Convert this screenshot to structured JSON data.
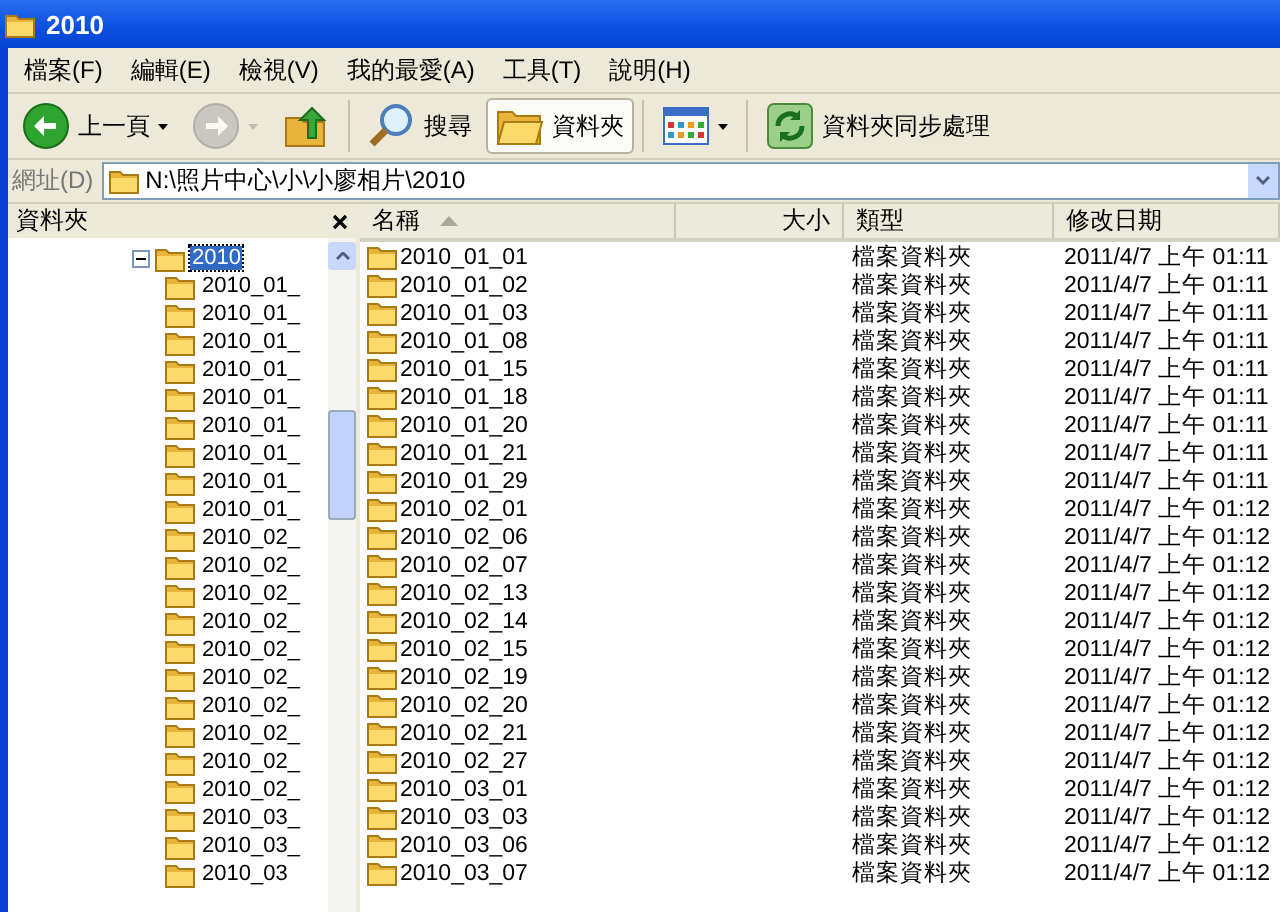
{
  "window": {
    "title": "2010"
  },
  "menu": [
    {
      "label": "檔案(F)"
    },
    {
      "label": "編輯(E)"
    },
    {
      "label": "檢視(V)"
    },
    {
      "label": "我的最愛(A)"
    },
    {
      "label": "工具(T)"
    },
    {
      "label": "說明(H)"
    }
  ],
  "toolbar": [
    {
      "kind": "back",
      "label": "上一頁",
      "disabled": false,
      "pressed": false
    },
    {
      "kind": "forward",
      "disabled": true,
      "pressed": false
    },
    {
      "kind": "up",
      "disabled": false,
      "pressed": false
    },
    {
      "kind": "search",
      "label": "搜尋",
      "disabled": false,
      "pressed": false
    },
    {
      "kind": "folders",
      "label": "資料夾",
      "disabled": false,
      "pressed": true
    },
    {
      "kind": "views",
      "disabled": false,
      "pressed": false
    },
    {
      "kind": "sync",
      "label": "資料夾同步處理",
      "disabled": false,
      "pressed": false
    }
  ],
  "address": {
    "label": "網址(D)",
    "value": "N:\\照片中心\\小\\小廖相片\\2010"
  },
  "folder_pane": {
    "title": "資料夾",
    "tree": [
      {
        "label": "2010",
        "expanded": true,
        "selected": true,
        "children": [
          {
            "label": "2010_01_"
          },
          {
            "label": "2010_01_"
          },
          {
            "label": "2010_01_"
          },
          {
            "label": "2010_01_"
          },
          {
            "label": "2010_01_"
          },
          {
            "label": "2010_01_"
          },
          {
            "label": "2010_01_"
          },
          {
            "label": "2010_01_"
          },
          {
            "label": "2010_01_"
          },
          {
            "label": "2010_02_"
          },
          {
            "label": "2010_02_"
          },
          {
            "label": "2010_02_"
          },
          {
            "label": "2010_02_"
          },
          {
            "label": "2010_02_"
          },
          {
            "label": "2010_02_"
          },
          {
            "label": "2010_02_"
          },
          {
            "label": "2010_02_"
          },
          {
            "label": "2010_02_"
          },
          {
            "label": "2010_02_"
          },
          {
            "label": "2010_03_"
          },
          {
            "label": "2010_03_"
          },
          {
            "label": "2010_03"
          }
        ]
      }
    ]
  },
  "file_list": {
    "columns": [
      {
        "label": "名稱",
        "sorted": true
      },
      {
        "label": "大小",
        "sorted": false
      },
      {
        "label": "類型",
        "sorted": false
      },
      {
        "label": "修改日期",
        "sorted": false
      }
    ],
    "rows": [
      {
        "name": "2010_01_01",
        "type": "檔案資料夾",
        "modified": "2011/4/7 上午 01:11"
      },
      {
        "name": "2010_01_02",
        "type": "檔案資料夾",
        "modified": "2011/4/7 上午 01:11"
      },
      {
        "name": "2010_01_03",
        "type": "檔案資料夾",
        "modified": "2011/4/7 上午 01:11"
      },
      {
        "name": "2010_01_08",
        "type": "檔案資料夾",
        "modified": "2011/4/7 上午 01:11"
      },
      {
        "name": "2010_01_15",
        "type": "檔案資料夾",
        "modified": "2011/4/7 上午 01:11"
      },
      {
        "name": "2010_01_18",
        "type": "檔案資料夾",
        "modified": "2011/4/7 上午 01:11"
      },
      {
        "name": "2010_01_20",
        "type": "檔案資料夾",
        "modified": "2011/4/7 上午 01:11"
      },
      {
        "name": "2010_01_21",
        "type": "檔案資料夾",
        "modified": "2011/4/7 上午 01:11"
      },
      {
        "name": "2010_01_29",
        "type": "檔案資料夾",
        "modified": "2011/4/7 上午 01:11"
      },
      {
        "name": "2010_02_01",
        "type": "檔案資料夾",
        "modified": "2011/4/7 上午 01:12"
      },
      {
        "name": "2010_02_06",
        "type": "檔案資料夾",
        "modified": "2011/4/7 上午 01:12"
      },
      {
        "name": "2010_02_07",
        "type": "檔案資料夾",
        "modified": "2011/4/7 上午 01:12"
      },
      {
        "name": "2010_02_13",
        "type": "檔案資料夾",
        "modified": "2011/4/7 上午 01:12"
      },
      {
        "name": "2010_02_14",
        "type": "檔案資料夾",
        "modified": "2011/4/7 上午 01:12"
      },
      {
        "name": "2010_02_15",
        "type": "檔案資料夾",
        "modified": "2011/4/7 上午 01:12"
      },
      {
        "name": "2010_02_19",
        "type": "檔案資料夾",
        "modified": "2011/4/7 上午 01:12"
      },
      {
        "name": "2010_02_20",
        "type": "檔案資料夾",
        "modified": "2011/4/7 上午 01:12"
      },
      {
        "name": "2010_02_21",
        "type": "檔案資料夾",
        "modified": "2011/4/7 上午 01:12"
      },
      {
        "name": "2010_02_27",
        "type": "檔案資料夾",
        "modified": "2011/4/7 上午 01:12"
      },
      {
        "name": "2010_03_01",
        "type": "檔案資料夾",
        "modified": "2011/4/7 上午 01:12"
      },
      {
        "name": "2010_03_03",
        "type": "檔案資料夾",
        "modified": "2011/4/7 上午 01:12"
      },
      {
        "name": "2010_03_06",
        "type": "檔案資料夾",
        "modified": "2011/4/7 上午 01:12"
      },
      {
        "name": "2010_03_07",
        "type": "檔案資料夾",
        "modified": "2011/4/7 上午 01:12"
      }
    ]
  }
}
